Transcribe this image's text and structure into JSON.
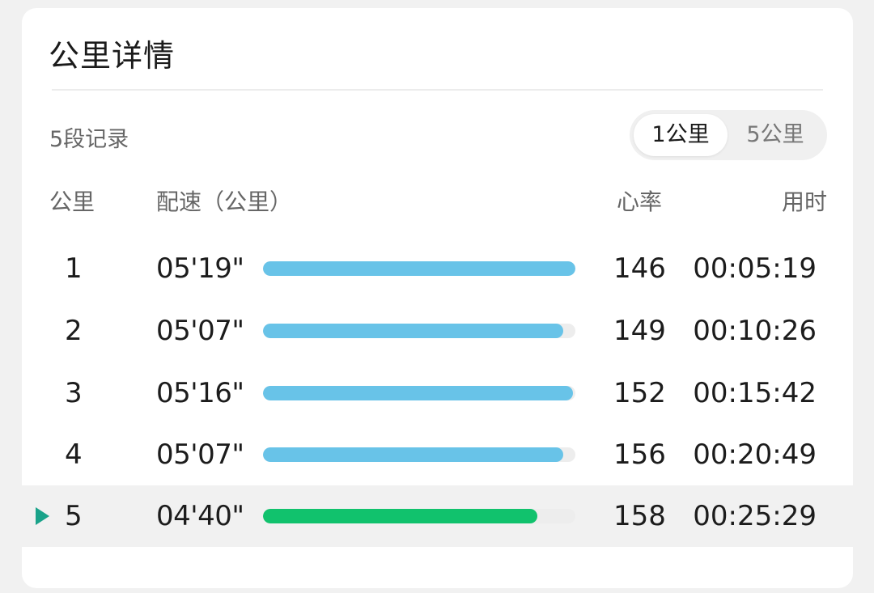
{
  "header": {
    "title": "公里详情"
  },
  "summary": {
    "record_count": "5段记录"
  },
  "toggle": {
    "options": [
      "1公里",
      "5公里"
    ],
    "selected": "1公里"
  },
  "table": {
    "columns": [
      "公里",
      "配速（公里）",
      "心率",
      "用时"
    ],
    "rows": [
      {
        "km": "1",
        "pace": "05'19\"",
        "pace_fraction": 1.0,
        "heart_rate": "146",
        "time": "00:05:19",
        "selected": false
      },
      {
        "km": "2",
        "pace": "05'07\"",
        "pace_fraction": 0.962,
        "heart_rate": "149",
        "time": "00:10:26",
        "selected": false
      },
      {
        "km": "3",
        "pace": "05'16\"",
        "pace_fraction": 0.991,
        "heart_rate": "152",
        "time": "00:15:42",
        "selected": false
      },
      {
        "km": "4",
        "pace": "05'07\"",
        "pace_fraction": 0.962,
        "heart_rate": "156",
        "time": "00:20:49",
        "selected": false
      },
      {
        "km": "5",
        "pace": "04'40\"",
        "pace_fraction": 0.877,
        "heart_rate": "158",
        "time": "00:25:29",
        "selected": true
      }
    ]
  },
  "colors": {
    "bar_normal": "#68c3e8",
    "bar_selected": "#11c26d",
    "selected_marker": "#1aa38a"
  },
  "icons": {
    "selected_marker": "play-triangle-icon"
  }
}
